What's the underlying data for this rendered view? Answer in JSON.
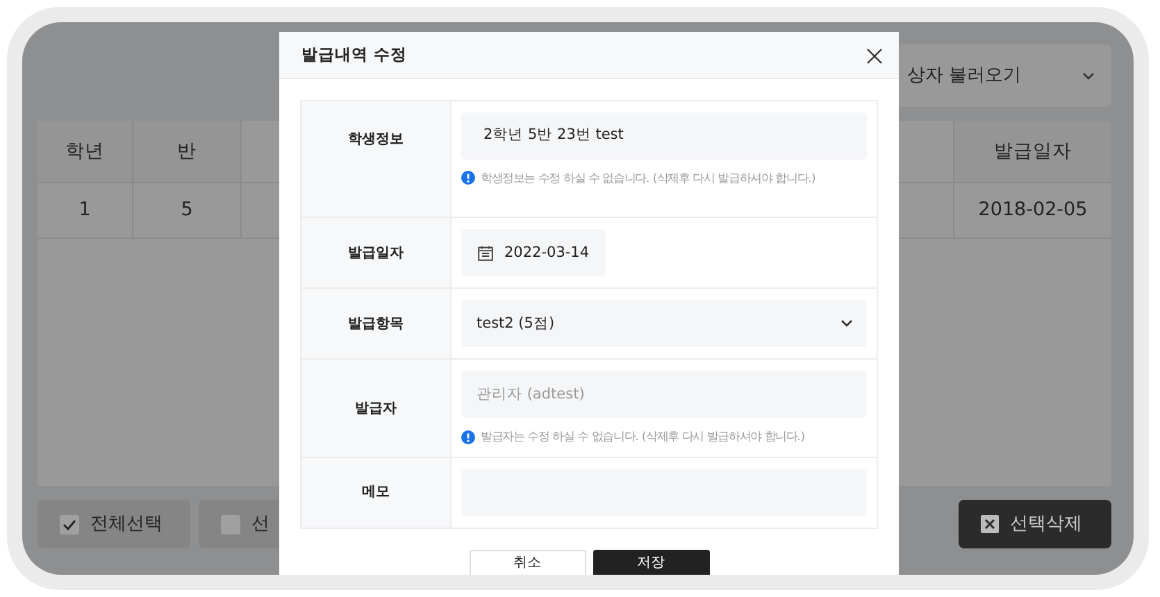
{
  "background": {
    "loader_dropdown": {
      "text": "상자 불러오기"
    },
    "table": {
      "columns": [
        "학년",
        "반",
        "발급일자"
      ],
      "rows": [
        [
          "1",
          "5",
          "2018-02-05"
        ]
      ]
    },
    "buttons": [
      {
        "label": "전체선택",
        "kind": "check",
        "checked": true
      },
      {
        "label": "선",
        "kind": "check",
        "checked": false
      },
      {
        "label": "선택삭제",
        "kind": "delete"
      }
    ]
  },
  "dialog": {
    "title": "발급내역 수정",
    "fields": [
      {
        "label": "학생정보",
        "kind": "readonly",
        "value": "2학년 5반 23번 test",
        "note": "학생정보는 수정 하실 수 없습니다. (삭제후 다시 발급하셔야 합니다.)"
      },
      {
        "label": "발급일자",
        "kind": "date",
        "value": "2022-03-14"
      },
      {
        "label": "발급항목",
        "kind": "select",
        "value": "test2 (5점)"
      },
      {
        "label": "발급자",
        "kind": "disabled",
        "value": "관리자 (adtest)",
        "note": "발급자는 수정 하실 수 없습니다. (삭제후 다시 발급하셔야 합니다.)"
      },
      {
        "label": "메모",
        "kind": "text"
      }
    ],
    "buttons": [
      {
        "label": "취소",
        "kind": "secondary"
      },
      {
        "label": "저장",
        "kind": "primary"
      }
    ]
  }
}
